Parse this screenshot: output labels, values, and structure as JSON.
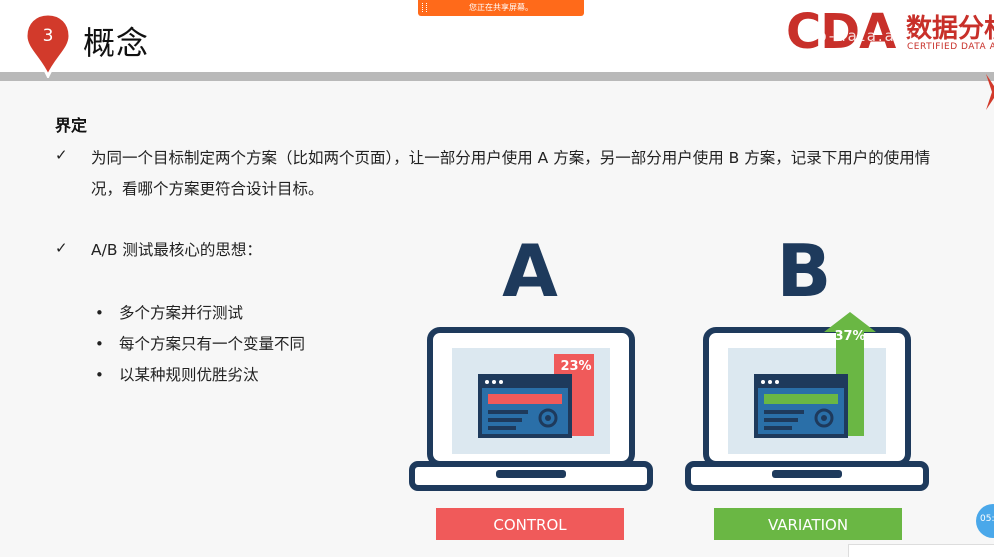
{
  "slide": {
    "number": "3",
    "title": "概念"
  },
  "share_banner": "您正在共享屏幕。",
  "logo": {
    "cda": "CDA",
    "cn": "数据分析",
    "en": "CERTIFIED DATA ANALYST",
    "watermark": "ob-data.afu..."
  },
  "content": {
    "heading": "界定",
    "check_mark": "✓",
    "definition": "为同一个目标制定两个方案（比如两个页面），让一部分用户使用 A 方案，另一部分用户使用 B 方案，记录下用户的使用情况，看哪个方案更符合设计目标。",
    "core_idea": "A/B 测试最核心的思想：",
    "bullet_mark": "•",
    "bullets": [
      "多个方案并行测试",
      "每个方案只有一个变量不同",
      "以某种规则优胜劣汰"
    ]
  },
  "illustration": {
    "a_letter": "A",
    "b_letter": "B",
    "a_percent": "23%",
    "b_percent": "37%",
    "a_label": "CONTROL",
    "b_label": "VARIATION",
    "colors": {
      "navy": "#1e3a5c",
      "red": "#f05a5a",
      "green": "#6ab744",
      "screen": "#dce8f0"
    }
  },
  "timer": "05:"
}
